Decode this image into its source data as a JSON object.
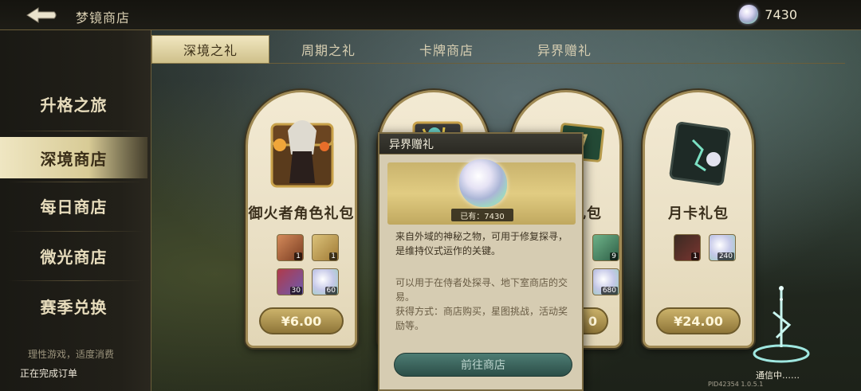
{
  "header": {
    "title": "梦镜商店",
    "currency_amount": "7430",
    "currency_icon": "rainbow-crystal-icon"
  },
  "sidebar": {
    "items": [
      {
        "label": "升格之旅"
      },
      {
        "label": "深境商店"
      },
      {
        "label": "每日商店"
      },
      {
        "label": "微光商店"
      },
      {
        "label": "赛季兑换"
      }
    ],
    "active_index": 1,
    "footer_notice": "理性游戏，适度消费",
    "status": "正在完成订单"
  },
  "tabs": [
    {
      "label": "深境之礼"
    },
    {
      "label": "周期之礼"
    },
    {
      "label": "卡牌商店"
    },
    {
      "label": "异界赠礼"
    }
  ],
  "cards": [
    {
      "title": "御火者角色礼包",
      "price": "¥6.00",
      "items": [
        {
          "icon": "character-portrait-icon",
          "count": "1"
        },
        {
          "icon": "key-scroll-icon",
          "count": "1"
        },
        {
          "icon": "red-crystal-icon",
          "count": "30"
        },
        {
          "icon": "rainbow-crystal-icon",
          "count": "60"
        }
      ]
    },
    {
      "title": "",
      "price": "",
      "items": []
    },
    {
      "title": "礼包",
      "price": "0",
      "items": [
        {
          "icon": "green-gem-icon",
          "count": "9"
        },
        {
          "icon": "rainbow-crystal-icon",
          "count": "680"
        }
      ]
    },
    {
      "title": "月卡礼包",
      "price": "¥24.00",
      "items": [
        {
          "icon": "rune-card-icon",
          "count": "1"
        },
        {
          "icon": "rainbow-crystal-icon",
          "count": "240"
        }
      ]
    }
  ],
  "popup": {
    "title": "异界赠礼",
    "owned": "已有：7430",
    "desc1": "来自外域的神秘之物，可用于修复探寻，是维持仪式运作的关键。",
    "desc2": "可以用于在侍者处探寻、地下室商店的交易。",
    "desc3": "获得方式：商店购买，星图挑战，活动奖励等。",
    "button": "前往商店"
  },
  "footer": {
    "comm_status": "通信中……",
    "version": "PID42354  1.0.5.1"
  }
}
